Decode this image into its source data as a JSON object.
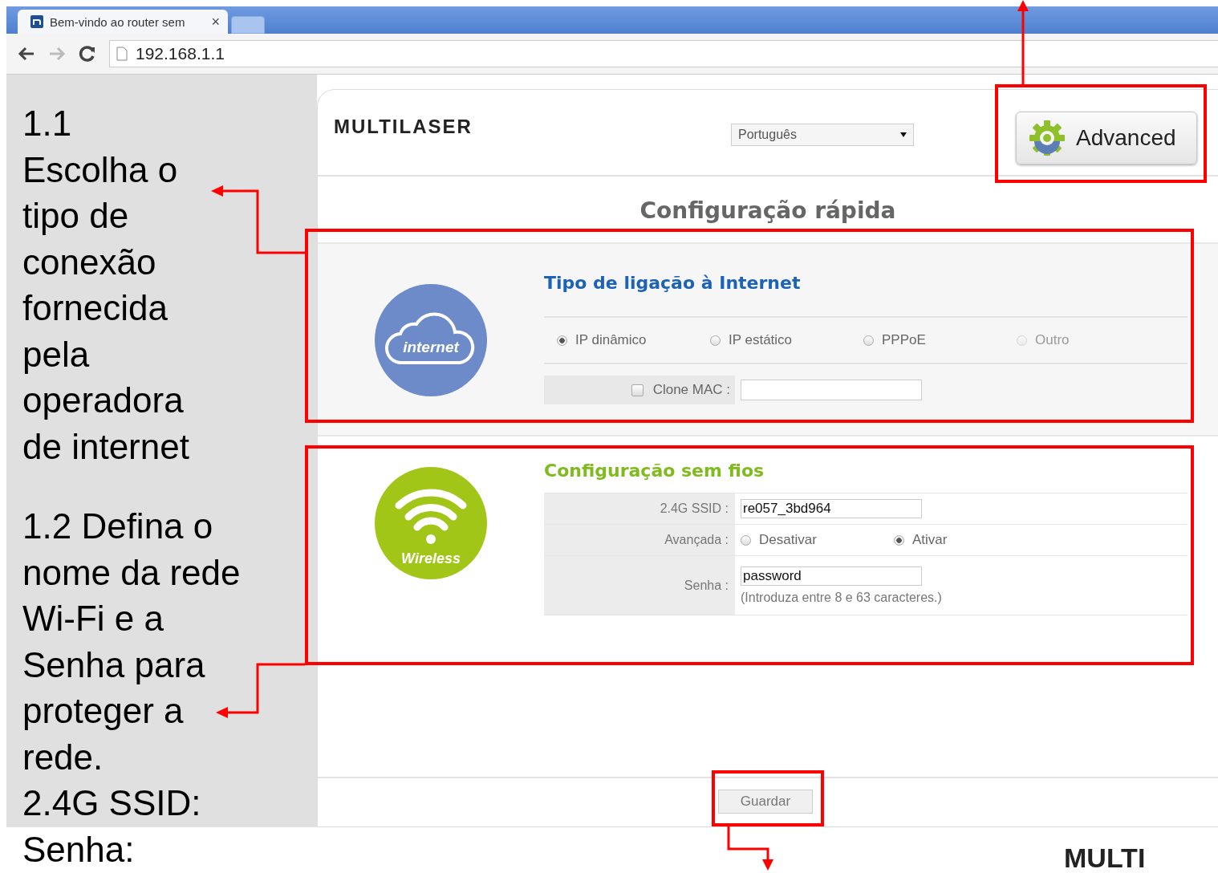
{
  "browser": {
    "tab_title": "Bem-vindo ao router sem",
    "tab_close": "×",
    "address": "192.168.1.1"
  },
  "notes": [
    {
      "heading": "1.1",
      "text": "Escolha o tipo de conexão fornecida pela operadora de internet"
    },
    {
      "text": "1.2 Defina o nome da rede Wi-Fi e a"
    },
    {
      "text": "Senha para proteger a rede."
    },
    {
      "text": "2.4G SSID:"
    },
    {
      "text": "Senha:"
    }
  ],
  "router": {
    "logo": "MULTILASER",
    "language": "Português",
    "advanced_button": "Advanced",
    "title": "Configuração rápida",
    "internet": {
      "icon_label": "internet",
      "heading": "Tipo de ligação à Internet",
      "connection_types": [
        {
          "label": "IP dinâmico",
          "selected": true,
          "disabled": false
        },
        {
          "label": "IP estático",
          "selected": false,
          "disabled": false
        },
        {
          "label": "PPPoE",
          "selected": false,
          "disabled": false
        },
        {
          "label": "Outro",
          "selected": false,
          "disabled": true
        }
      ],
      "clone_mac": {
        "label": "Clone MAC :",
        "checked": false
      }
    },
    "wireless": {
      "icon_label": "Wireless",
      "heading": "Configuração sem fios",
      "ssid": {
        "label": "2.4G SSID :",
        "value": "re057_3bd964"
      },
      "advanced": {
        "label": "Avançada :",
        "options": [
          {
            "label": "Desativar",
            "selected": false
          },
          {
            "label": "Ativar",
            "selected": true
          }
        ]
      },
      "password": {
        "label": "Senha :",
        "value": "password",
        "hint": "(Introduza entre 8 e 63 caracteres.)"
      }
    },
    "save_button": "Guardar"
  },
  "footer_logo": "MULTI"
}
